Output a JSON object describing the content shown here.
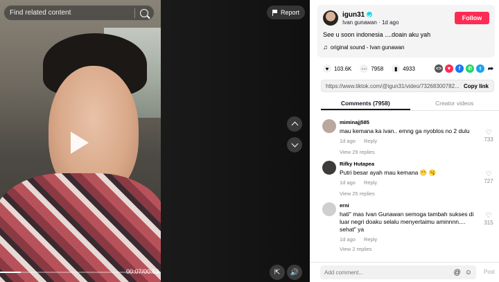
{
  "search": {
    "placeholder": "Find related content"
  },
  "video": {
    "report_label": "Report",
    "time": "00:07/00:53",
    "progress": 0.13
  },
  "author": {
    "username": "igun31",
    "display_name": "Ivan gunawan",
    "age": "1d ago",
    "follow_label": "Follow"
  },
  "post": {
    "caption": "See u soon indonesia ....doain aku yah",
    "sound": "original sound - Ivan gunawan"
  },
  "stats": {
    "likes": "103.6K",
    "comments": "7958",
    "saves": "4933"
  },
  "share": {
    "link": "https://www.tiktok.com/@igun31/video/73268300782...",
    "copy_label": "Copy link"
  },
  "tabs": [
    {
      "label": "Comments (7958)"
    },
    {
      "label": "Creator videos"
    }
  ],
  "comments": [
    {
      "user": "miminajj585",
      "text": "mau kemana ka ivan.. emng ga nyoblos no 2 dulu",
      "age": "1d ago",
      "reply": "Reply",
      "replies": "View 29 replies",
      "likes": "733"
    },
    {
      "user": "Rifky Hutapea",
      "text": "Putri besar ayah mau kemana 😬 🥱",
      "age": "1d ago",
      "reply": "Reply",
      "replies": "View 25 replies",
      "likes": "727"
    },
    {
      "user": "erni",
      "text": "hati\" mas Ivan Gunawan semoga tambah sukses di luar negri doaku selalu menyertaimu aminnnn.... sehat\" ya",
      "age": "1d ago",
      "reply": "Reply",
      "replies": "View 2 replies",
      "likes": "315"
    }
  ],
  "composer": {
    "placeholder": "Add comment...",
    "post_label": "Post"
  }
}
